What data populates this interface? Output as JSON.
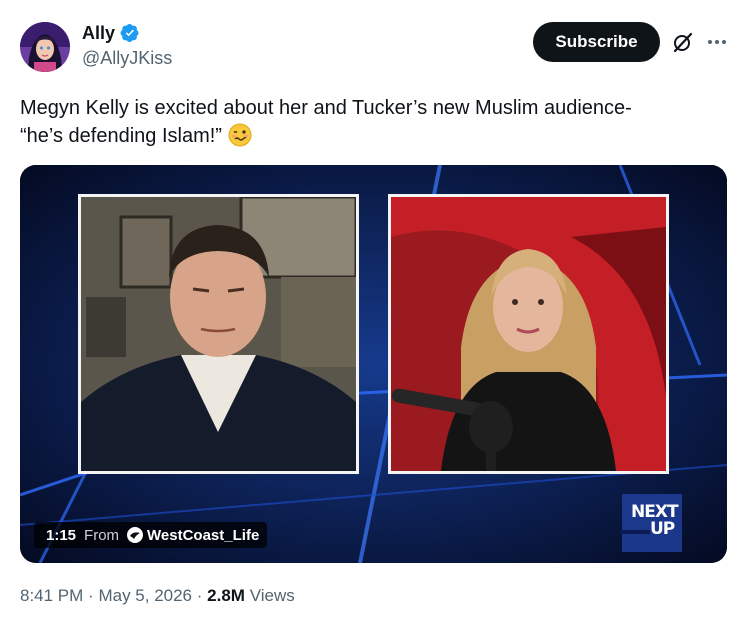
{
  "author": {
    "name": "Ally",
    "handle": "@AllyJKiss",
    "verified_color": "#1d9bf0"
  },
  "header": {
    "subscribe_label": "Subscribe",
    "icons": [
      "grok-icon",
      "more-icon"
    ]
  },
  "tweet": {
    "line1": "Megyn Kelly is excited about her and Tucker’s new Muslim audience-",
    "line2": "“he’s defending Islam!”",
    "emoji": "woozy-face-emoji"
  },
  "video": {
    "duration": "1:15",
    "from_label": "From",
    "source": "WestCoast_Life",
    "badge_line1": "NEXT",
    "badge_line2": "UP"
  },
  "meta": {
    "time": "8:41 PM",
    "sep1": "·",
    "date": "May 5, 2026",
    "sep2": "·",
    "views_count": "2.8M",
    "views_label": "Views"
  },
  "colors": {
    "text": "#0f1419",
    "secondary": "#536471",
    "button_bg": "#0f1419",
    "accent": "#1d9bf0"
  }
}
